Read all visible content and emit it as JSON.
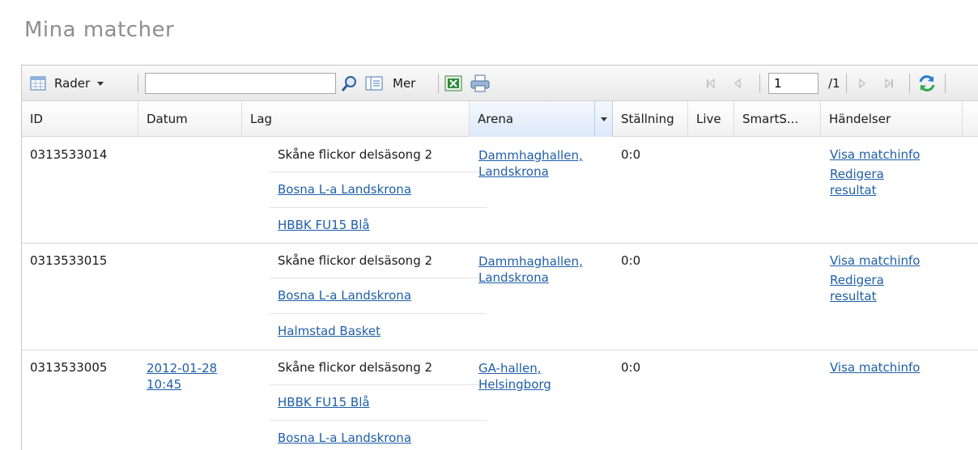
{
  "page": {
    "title": "Mina matcher"
  },
  "toolbar": {
    "rows_label": "Rader",
    "search": {
      "value": "",
      "placeholder": ""
    },
    "more_label": "Mer",
    "pager": {
      "current_page": "1",
      "total_pages": "/1"
    }
  },
  "columns": [
    {
      "key": "id",
      "label": "ID"
    },
    {
      "key": "datum",
      "label": "Datum"
    },
    {
      "key": "lag",
      "label": "Lag"
    },
    {
      "key": "arena",
      "label": "Arena"
    },
    {
      "key": "stallning",
      "label": "Ställning"
    },
    {
      "key": "live",
      "label": "Live"
    },
    {
      "key": "smarts",
      "label": "SmartS..."
    },
    {
      "key": "handelser",
      "label": "Händelser"
    }
  ],
  "rows": [
    {
      "id": "0313533014",
      "datum": "",
      "tavling": "Skåne flickor delsäsong 2",
      "lag1": "Bosna L-a Landskrona",
      "lag2": "HBBK FU15 Blå",
      "arena_line1": "Dammhaghallen,",
      "arena_line2": "Landskrona",
      "stallning": "0:0",
      "event1": "Visa matchinfo",
      "event2_line1": "Redigera",
      "event2_line2": "resultat"
    },
    {
      "id": "0313533015",
      "datum": "",
      "tavling": "Skåne flickor delsäsong 2",
      "lag1": "Bosna L-a Landskrona",
      "lag2": "Halmstad Basket",
      "arena_line1": "Dammhaghallen,",
      "arena_line2": "Landskrona",
      "stallning": "0:0",
      "event1": "Visa matchinfo",
      "event2_line1": "Redigera",
      "event2_line2": "resultat"
    },
    {
      "id": "0313533005",
      "datum_line1": "2012-01-28",
      "datum_line2": "10:45",
      "tavling": "Skåne flickor delsäsong 2",
      "lag1": "HBBK FU15 Blå",
      "lag2": "Bosna L-a Landskrona",
      "arena_line1": "GA-hallen,",
      "arena_line2": "Helsingborg",
      "stallning": "0:0",
      "event1": "Visa matchinfo"
    }
  ],
  "colors": {
    "link": "#1f5fa8",
    "title": "#8e8e8e",
    "sorted_header": "#dce9f8"
  },
  "icons": {
    "rows": "grid-icon",
    "dropdown": "caret-down-icon",
    "search": "magnifier-icon",
    "more": "columns-icon",
    "excel": "excel-icon",
    "print": "printer-icon",
    "first": "first-page-icon",
    "prev": "prev-page-icon",
    "next": "next-page-icon",
    "last": "last-page-icon",
    "refresh": "refresh-icon"
  }
}
